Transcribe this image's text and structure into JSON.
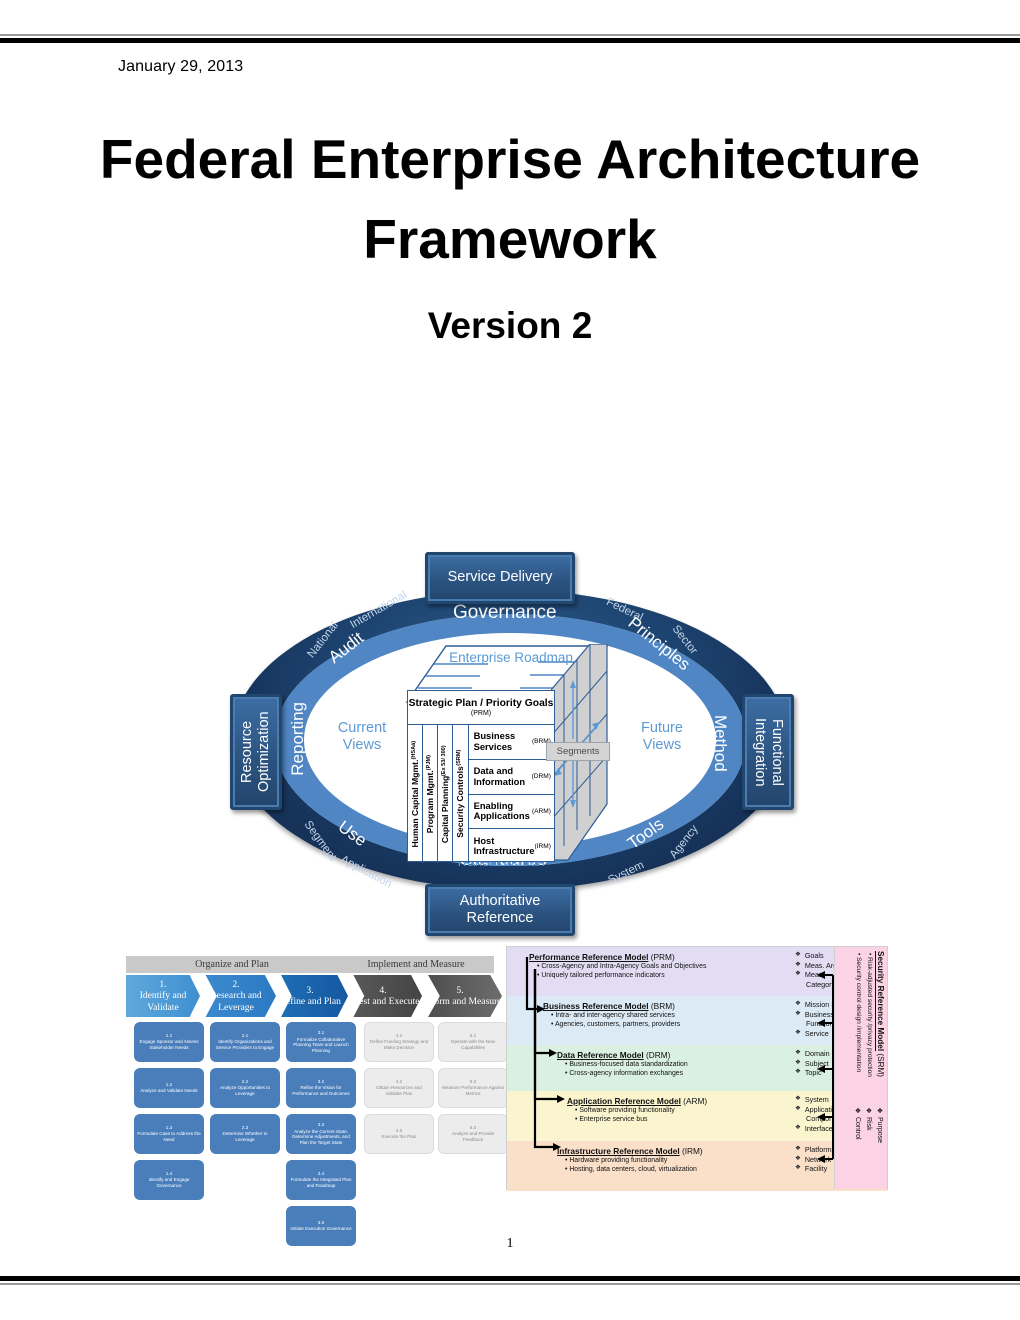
{
  "document": {
    "date": "January 29, 2013",
    "title_line1": "Federal Enterprise Architecture",
    "title_line2": "Framework",
    "version": "Version 2",
    "page_number": "1"
  },
  "feaf_diagram": {
    "edge_boxes": {
      "top": "Service Delivery",
      "bottom": "Authoritative Reference",
      "left": "Resource Optimization",
      "right": "Functional Integration"
    },
    "outer_ring_labels": [
      "National",
      "International",
      "Federal",
      "Sector",
      "Agency",
      "System",
      "Application",
      "Segment"
    ],
    "mid_ring_labels": [
      "Audit",
      "Governance",
      "Principles",
      "Method",
      "Tools",
      "Standards",
      "Use",
      "Reporting"
    ],
    "interior": {
      "current_views": "Current Views",
      "future_views": "Future Views",
      "transition_plan": "Transition Plan",
      "enterprise_roadmap": "Enterprise Roadmap",
      "segments_tag": "Segments"
    },
    "cube": {
      "strategic_row": {
        "title": "Strategic Plan / Priority Goals",
        "abbrev": "(PRM)"
      },
      "side_columns": [
        {
          "label": "Human Capital Mgmt.",
          "abbrev": "(HSAá)"
        },
        {
          "label": "Program Mgmt.",
          "abbrev": "(PJM)"
        },
        {
          "label": "Capital Planning",
          "abbrev": "(Ex 53/ 300)"
        },
        {
          "label": "Security Controls",
          "abbrev": "(SRM)"
        }
      ],
      "layers": [
        {
          "name": "Business Services",
          "abbrev": "(BRM)"
        },
        {
          "name": "Data and Information",
          "abbrev": "(DRM)"
        },
        {
          "name": "Enabling Applications",
          "abbrev": "(ARM)"
        },
        {
          "name": "Host Infrastructure",
          "abbrev": "(IRM)"
        }
      ]
    }
  },
  "cpm_flow": {
    "phases": [
      {
        "label": "Organize and Plan"
      },
      {
        "label": "Implement and Measure"
      }
    ],
    "steps": [
      {
        "num": "1.",
        "label": "Identify and Validate"
      },
      {
        "num": "2.",
        "label": "Research and Leverage"
      },
      {
        "num": "3.",
        "label": "Define and Plan"
      },
      {
        "num": "4.",
        "label": "Invest and Execute"
      },
      {
        "num": "5.",
        "label": "Perform and Measure"
      }
    ],
    "columns": [
      {
        "style": "blue",
        "items": [
          {
            "id": "1.1",
            "label": "Engage Sponsor and Assess Stakeholder Needs"
          },
          {
            "id": "1.2",
            "label": "Analyze and Validate Needs"
          },
          {
            "id": "1.3",
            "label": "Formulate Case to Address the Need"
          },
          {
            "id": "1.4",
            "label": "Identify and Engage Governance"
          }
        ]
      },
      {
        "style": "blue",
        "items": [
          {
            "id": "2.1",
            "label": "Identify Organizations and Service Providers to Engage"
          },
          {
            "id": "2.2",
            "label": "Analyze Opportunities to Leverage"
          },
          {
            "id": "2.3",
            "label": "Determine Whether to Leverage"
          }
        ]
      },
      {
        "style": "blue",
        "items": [
          {
            "id": "3.1",
            "label": "Formalize Collaborative Planning Team and Launch Planning"
          },
          {
            "id": "3.2",
            "label": "Refine the Vision for Performance and Outcomes"
          },
          {
            "id": "3.3",
            "label": "Analyze the Current State, Determine Adjustments, and Plan the Target State"
          },
          {
            "id": "3.4",
            "label": "Formulate the Integrated Plan and Roadmap"
          },
          {
            "id": "3.5",
            "label": "Initiate Execution Governance"
          }
        ]
      },
      {
        "style": "grey",
        "items": [
          {
            "id": "4.1",
            "label": "Define Funding Strategy and Make Decision"
          },
          {
            "id": "4.2",
            "label": "Obtain Resources and Validate Plan"
          },
          {
            "id": "4.3",
            "label": "Execute the Plan"
          }
        ]
      },
      {
        "style": "grey",
        "items": [
          {
            "id": "5.1",
            "label": "Operate with the New Capabilities"
          },
          {
            "id": "5.2",
            "label": "Measure Performance Against Metrics"
          },
          {
            "id": "5.3",
            "label": "Analyze and Provide Feedback"
          }
        ]
      }
    ]
  },
  "reference_models": {
    "bands": [
      {
        "title_bold": "Performance Reference Model",
        "title_rest": " (PRM)",
        "bullets": [
          "Cross-Agency and Intra-Agency Goals and Objectives",
          "Uniquely tailored performance indicators"
        ],
        "keys": [
          "Goals",
          "Meas. Area",
          "Meas.",
          "Category"
        ],
        "color": "#e2ddf2"
      },
      {
        "title_bold": "Business Reference Model",
        "title_rest": " (BRM)",
        "bullets": [
          "Intra- and inter-agency shared services",
          "Agencies, customers, partners, providers"
        ],
        "keys": [
          "Mission Sector",
          "Business",
          "Function",
          "Service"
        ],
        "color": "#dbeaf5"
      },
      {
        "title_bold": "Data Reference Model",
        "title_rest": " (DRM)",
        "bullets": [
          "Business-focused data standardization",
          "Cross-agency information exchanges"
        ],
        "keys": [
          "Domain",
          "Subject",
          "Topic"
        ],
        "color": "#daf0e0"
      },
      {
        "title_bold": "Application Reference Model",
        "title_rest": " (ARM)",
        "bullets": [
          "Software providing functionality",
          "Enterprise service bus"
        ],
        "keys": [
          "System",
          "Application",
          "Component",
          "Interface"
        ],
        "color": "#faf5cf"
      },
      {
        "title_bold": "Infrastructure Reference Model",
        "title_rest": " (IRM)",
        "bullets": [
          "Hardware providing functionality",
          "Hosting, data centers, cloud, virtualization"
        ],
        "keys": [
          "Platform",
          "Network",
          "Facility"
        ],
        "color": "#fadfc9"
      }
    ],
    "srm": {
      "title_bold": "Security Reference Model",
      "title_rest": " (SRM)",
      "bullets": [
        "Risk-adjusted security /privacy protection",
        "Security control design /implementation"
      ],
      "keys": [
        "Purpose",
        "Risk",
        "Control"
      ]
    }
  },
  "colors": {
    "ring_outer": "#1d4470",
    "ring_mid": "#4f86c3",
    "box_blue": "#2c5481",
    "accent_light_blue": "#5b9bd5",
    "cpm_blue": "#4a7ebb",
    "cpm_grey": "#ececec"
  }
}
